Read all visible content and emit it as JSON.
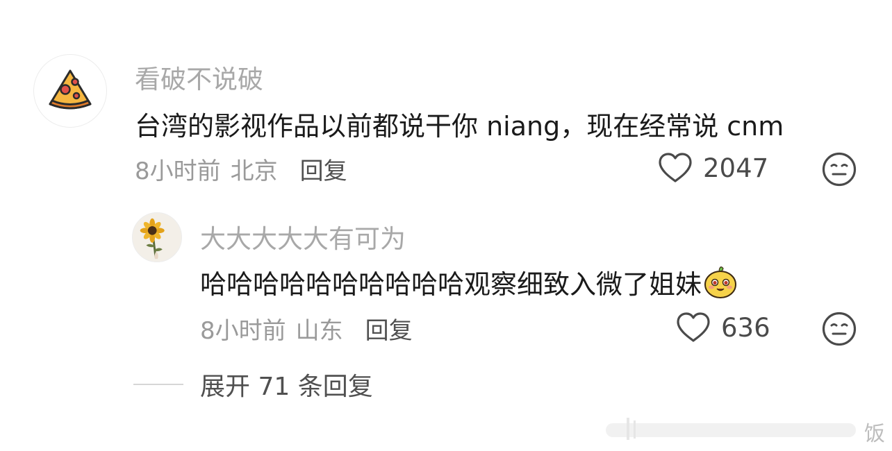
{
  "comment": {
    "username": "看破不说破",
    "text": "台湾的影视作品以前都说干你 niang，现在经常说 cnm",
    "time": "8小时前",
    "location": "北京",
    "reply_label": "回复",
    "like_count": "2047"
  },
  "reply": {
    "username": "大大大大大有可为",
    "text": "哈哈哈哈哈哈哈哈哈哈观察细致入微了姐妹",
    "time": "8小时前",
    "location": "山东",
    "reply_label": "回复",
    "like_count": "636"
  },
  "expand": {
    "label": "展开 71 条回复"
  },
  "watermark": {
    "text": "饭"
  },
  "colors": {
    "username": "#a8a8a8",
    "text": "#1a1a1a",
    "meta": "#9a9a9a",
    "pizza_crust": "#e07b2a",
    "pizza_cheese": "#f5b640",
    "pepperoni": "#e0504a"
  }
}
